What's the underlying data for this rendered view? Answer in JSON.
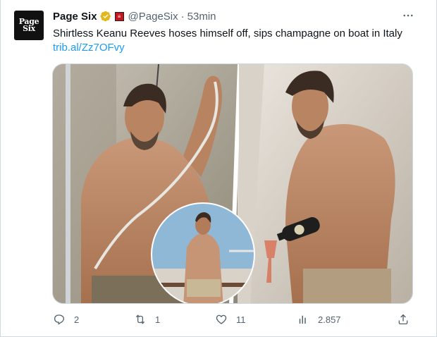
{
  "tweet": {
    "author_name": "Page Six",
    "handle": "@PageSix",
    "separator": "·",
    "time": "53min",
    "avatar_text": [
      "Page",
      "Six"
    ],
    "verified_icon": "verified-badge-gold",
    "affiliation_icon": "affiliate-badge",
    "text": "Shirtless Keanu Reeves hoses himself off, sips champagne on boat in Italy",
    "link": "trib.al/Zz7OFvy",
    "more_icon": "more-icon"
  },
  "actions": {
    "replies": "2",
    "retweets": "1",
    "likes": "11",
    "views": "2.857"
  },
  "colors": {
    "accent": "#1d9bf0",
    "muted": "#536471",
    "border": "#cfd9de",
    "badge_gold": "#e2b719",
    "affiliate_red": "#c4161c"
  }
}
